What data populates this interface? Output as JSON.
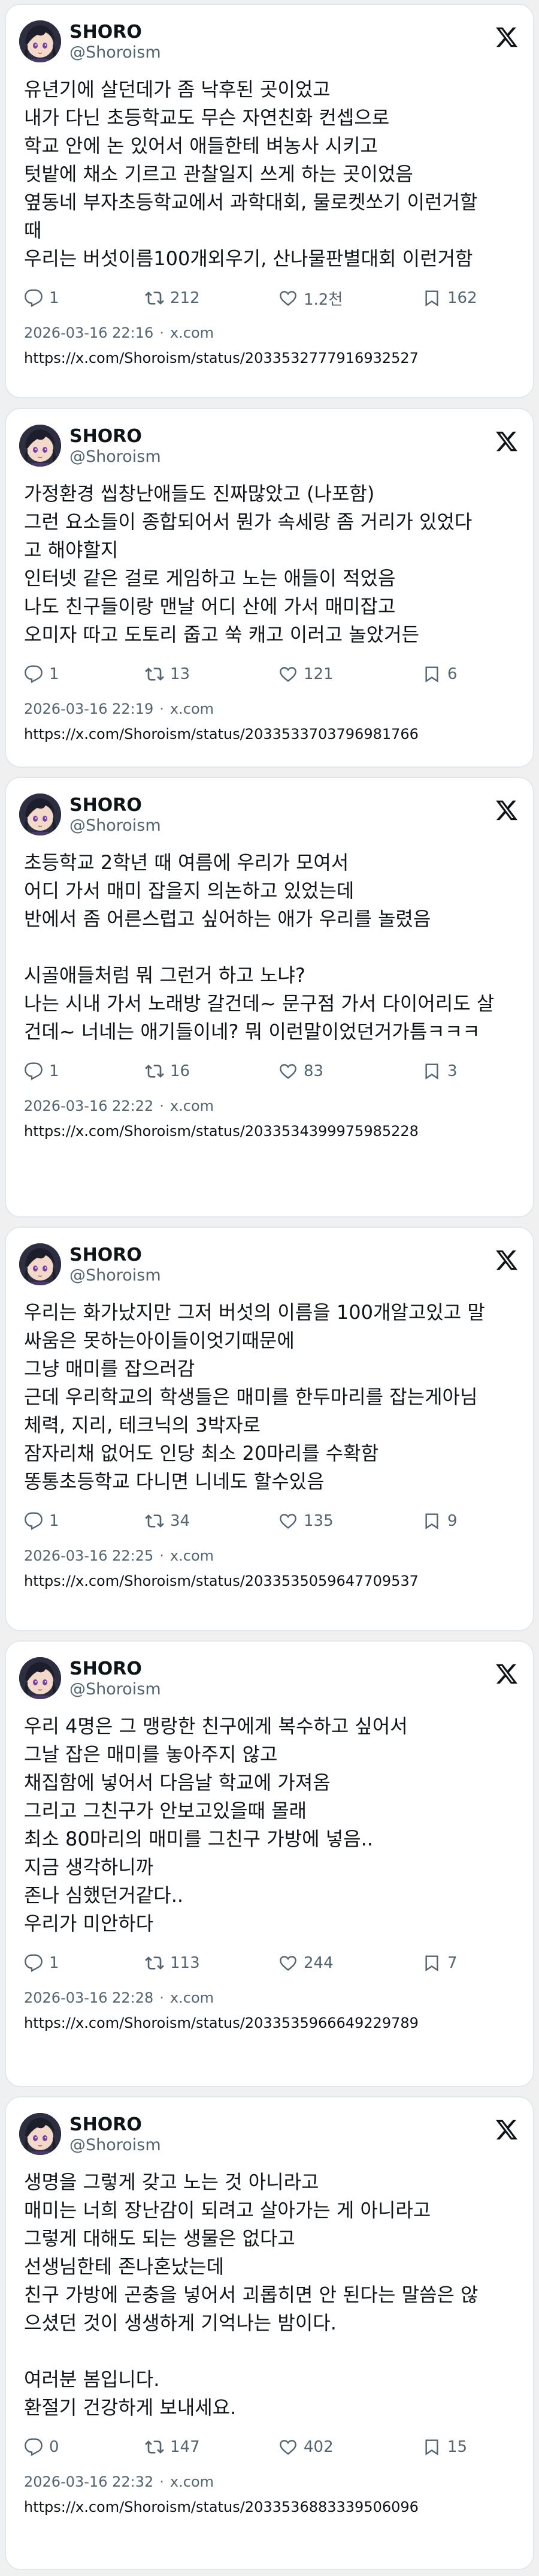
{
  "tweets": [
    {
      "name": "SHORO",
      "handle": "@Shoroism",
      "lines": [
        "유년기에 살던데가 좀 낙후된 곳이었고",
        "내가 다닌 초등학교도 무슨 자연친화 컨셉으로",
        "학교 안에 논 있어서 애들한테 벼농사 시키고",
        "텃밭에 채소 기르고 관찰일지 쓰게 하는 곳이었음",
        "옆동네 부자초등학교에서 과학대회, 물로켓쏘기 이런거할",
        "때",
        "우리는 버섯이름100개외우기, 산나물판별대회 이런거함"
      ],
      "replies": "1",
      "retweets": "212",
      "likes": "1.2천",
      "bookmarks": "162",
      "timestamp": "2026-03-16 22:16",
      "source": "x.com",
      "url": "https://x.com/Shoroism/status/2033532777916932527"
    },
    {
      "name": "SHORO",
      "handle": "@Shoroism",
      "lines": [
        "가정환경 씹창난애들도 진짜많았고 (나포함)",
        "그런 요소들이 종합되어서 뭔가 속세랑 좀 거리가 있었다",
        "고 해야할지",
        "인터넷 같은 걸로 게임하고 노는 애들이 적었음",
        "나도 친구들이랑 맨날 어디 산에 가서 매미잡고",
        "오미자 따고 도토리 줍고 쑥 캐고 이러고 놀았거든"
      ],
      "replies": "1",
      "retweets": "13",
      "likes": "121",
      "bookmarks": "6",
      "timestamp": "2026-03-16 22:19",
      "source": "x.com",
      "url": "https://x.com/Shoroism/status/2033533703796981766"
    },
    {
      "name": "SHORO",
      "handle": "@Shoroism",
      "lines": [
        "초등학교 2학년 때 여름에 우리가 모여서",
        "어디 가서 매미 잡을지 의논하고 있었는데",
        "반에서 좀 어른스럽고 싶어하는 애가 우리를 놀렸음",
        "",
        "시골애들처럼 뭐 그런거 하고 노냐?",
        "나는 시내 가서 노래방 갈건데~ 문구점 가서 다이어리도 살",
        "건데~ 너네는 애기들이네? 뭐 이런말이었던거가틈ㅋㅋㅋ"
      ],
      "replies": "1",
      "retweets": "16",
      "likes": "83",
      "bookmarks": "3",
      "timestamp": "2026-03-16 22:22",
      "source": "x.com",
      "url": "https://x.com/Shoroism/status/2033534399975985228"
    },
    {
      "name": "SHORO",
      "handle": "@Shoroism",
      "lines": [
        "우리는 화가났지만  그저 버섯의 이름을 100개알고있고 말",
        "싸움은 못하는아이들이엇기때문에",
        "그냥  매미를 잡으러감",
        "근데 우리학교의 학생들은 매미를 한두마리를 잡는게아님",
        "체력, 지리, 테크닉의 3박자로",
        "잠자리채 없어도 인당 최소 20마리를 수확함",
        "똥통초등학교 다니면 니네도 할수있음"
      ],
      "replies": "1",
      "retweets": "34",
      "likes": "135",
      "bookmarks": "9",
      "timestamp": "2026-03-16 22:25",
      "source": "x.com",
      "url": "https://x.com/Shoroism/status/2033535059647709537"
    },
    {
      "name": "SHORO",
      "handle": "@Shoroism",
      "lines": [
        "우리 4명은 그 맹랑한 친구에게 복수하고 싶어서",
        "그날 잡은 매미를 놓아주지 않고",
        "채집함에 넣어서 다음날 학교에 가져옴",
        "그리고 그친구가 안보고있을때 몰래",
        "최소 80마리의 매미를  그친구 가방에 넣음..",
        "지금 생각하니까",
        "존나 심했던거같다..",
        "우리가 미안하다"
      ],
      "replies": "1",
      "retweets": "113",
      "likes": "244",
      "bookmarks": "7",
      "timestamp": "2026-03-16 22:28",
      "source": "x.com",
      "url": "https://x.com/Shoroism/status/2033535966649229789"
    },
    {
      "name": "SHORO",
      "handle": "@Shoroism",
      "lines": [
        "생명을 그렇게 갖고 노는 것 아니라고",
        "매미는 너희 장난감이 되려고 살아가는 게 아니라고",
        "그렇게 대해도 되는 생물은 없다고",
        "선생님한테 존나혼났는데",
        "친구 가방에 곤충을 넣어서 괴롭히면 안 된다는 말씀은 않",
        "으셨던 것이 생생하게 기억나는 밤이다.",
        "",
        "여러분 봄입니다.",
        "환절기 건강하게 보내세요."
      ],
      "replies": "0",
      "retweets": "147",
      "likes": "402",
      "bookmarks": "15",
      "timestamp": "2026-03-16 22:32",
      "source": "x.com",
      "url": "https://x.com/Shoroism/status/2033536883339506096"
    }
  ],
  "colors": {
    "background": "#f0f0f0",
    "card": "#ffffff",
    "text": "#0f1419",
    "muted": "#536471"
  },
  "icons": {
    "reply": "reply-icon",
    "retweet": "retweet-icon",
    "like": "heart-icon",
    "bookmark": "bookmark-icon",
    "x_logo": "x-logo-icon",
    "avatar": "avatar"
  }
}
